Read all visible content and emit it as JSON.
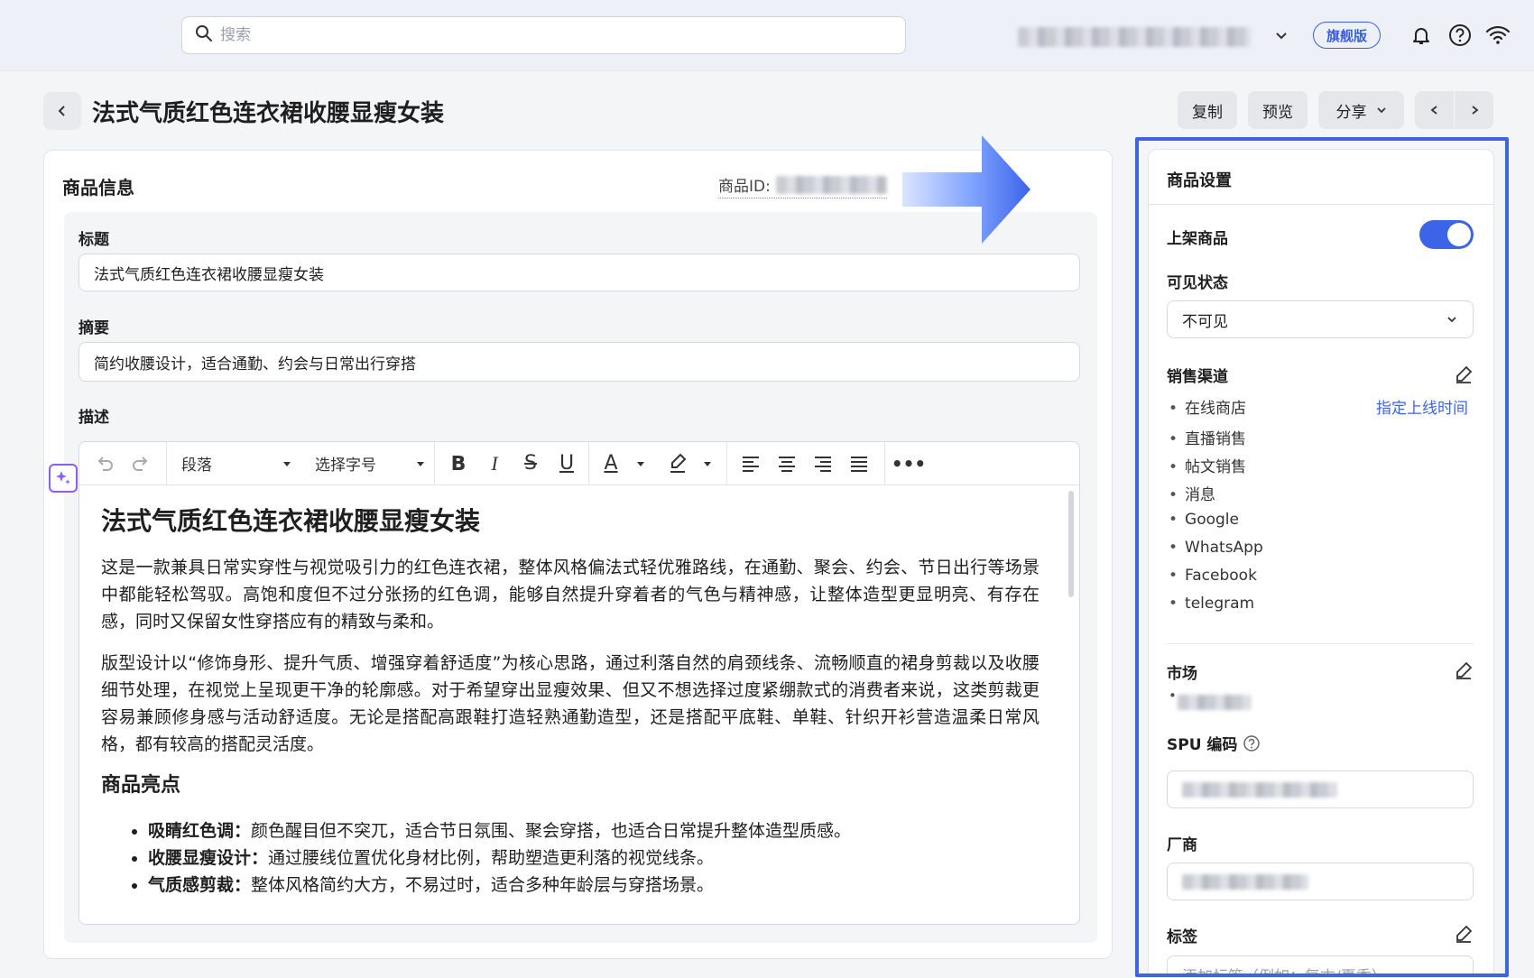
{
  "topbar": {
    "search_placeholder": "搜索",
    "plan_badge": "旗舰版"
  },
  "header": {
    "title": "法式气质红色连衣裙收腰显瘦女装",
    "copy_label": "复制",
    "preview_label": "预览",
    "share_label": "分享"
  },
  "product_info": {
    "section_title": "商品信息",
    "product_id_label": "商品ID:",
    "title_label": "标题",
    "title_value": "法式气质红色连衣裙收腰显瘦女装",
    "summary_label": "摘要",
    "summary_value": "简约收腰设计，适合通勤、约会与日常出行穿搭",
    "description_label": "描述",
    "toolbar": {
      "paragraph_select": "段落",
      "font_size_select": "选择字号"
    },
    "description": {
      "heading": "法式气质红色连衣裙收腰显瘦女装",
      "para1": "这是一款兼具日常实穿性与视觉吸引力的红色连衣裙，整体风格偏法式轻优雅路线，在通勤、聚会、约会、节日出行等场景中都能轻松驾驭。高饱和度但不过分张扬的红色调，能够自然提升穿着者的气色与精神感，让整体造型更显明亮、有存在感，同时又保留女性穿搭应有的精致与柔和。",
      "para2": "版型设计以“修饰身形、提升气质、增强穿着舒适度”为核心思路，通过利落自然的肩颈线条、流畅顺直的裙身剪裁以及收腰细节处理，在视觉上呈现更干净的轮廓感。对于希望穿出显瘦效果、但又不想选择过度紧绷款式的消费者来说，这类剪裁更容易兼顾修身感与活动舒适度。无论是搭配高跟鞋打造轻熟通勤造型，还是搭配平底鞋、单鞋、针织开衫营造温柔日常风格，都有较高的搭配灵活度。",
      "highlights_heading": "商品亮点",
      "bullets": [
        {
          "bold": "吸睛红色调：",
          "text": "颜色醒目但不突兀，适合节日氛围、聚会穿搭，也适合日常提升整体造型质感。"
        },
        {
          "bold": "收腰显瘦设计：",
          "text": "通过腰线位置优化身材比例，帮助塑造更利落的视觉线条。"
        },
        {
          "bold": "气质感剪裁：",
          "text": "整体风格简约大方，不易过时，适合多种年龄层与穿搭场景。"
        }
      ]
    }
  },
  "settings": {
    "title": "商品设置",
    "publish_label": "上架商品",
    "publish_on": true,
    "visibility_label": "可见状态",
    "visibility_value": "不可见",
    "channels_label": "销售渠道",
    "schedule_link": "指定上线时间",
    "channels": [
      "在线商店",
      "直播销售",
      "帖文销售",
      "消息",
      "Google",
      "WhatsApp",
      "Facebook",
      "telegram"
    ],
    "market_label": "市场",
    "spu_label": "SPU 编码",
    "vendor_label": "厂商",
    "tags_label": "标签",
    "tags_placeholder": "添加标签（例如：复古/夏季）"
  },
  "colors": {
    "accent": "#3b64e8",
    "ai_purple": "#8b5cf6"
  }
}
